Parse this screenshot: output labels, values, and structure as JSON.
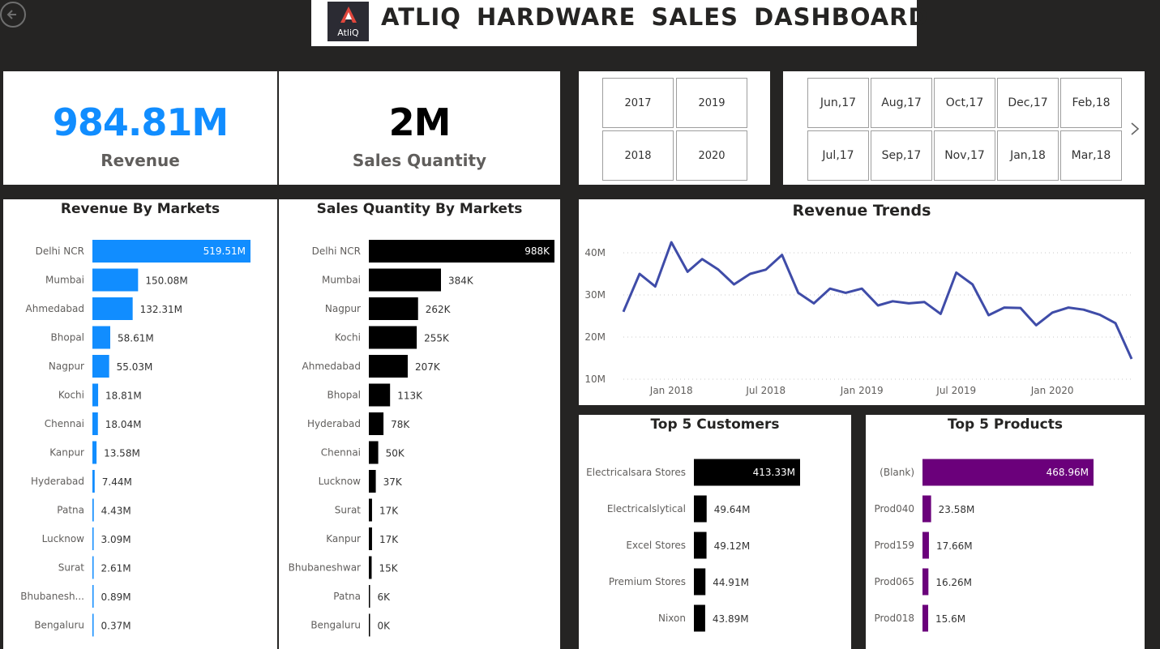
{
  "header": {
    "title": "ATLIQ  HARDWARE  SALES  DASHBOARD",
    "logo_text": "AtliQ"
  },
  "kpis": {
    "revenue": {
      "value": "984.81M",
      "label": "Revenue",
      "color": "#118dff"
    },
    "sales_qty": {
      "value": "2M",
      "label": "Sales Quantity",
      "color": "#000000"
    }
  },
  "year_slicer": {
    "options": [
      "2017",
      "2019",
      "2018",
      "2020"
    ]
  },
  "month_slicer": {
    "options": [
      "Jun,17",
      "Aug,17",
      "Oct,17",
      "Dec,17",
      "Feb,18",
      "Jul,17",
      "Sep,17",
      "Nov,17",
      "Jan,18",
      "Mar,18"
    ]
  },
  "chart_data": [
    {
      "type": "bar",
      "title": "Revenue By Markets",
      "categories": [
        "Delhi NCR",
        "Mumbai",
        "Ahmedabad",
        "Bhopal",
        "Nagpur",
        "Kochi",
        "Chennai",
        "Kanpur",
        "Hyderabad",
        "Patna",
        "Lucknow",
        "Surat",
        "Bhubanesh...",
        "Bengaluru"
      ],
      "values": [
        519.51,
        150.08,
        132.31,
        58.61,
        55.03,
        18.81,
        18.04,
        13.58,
        7.44,
        4.43,
        3.09,
        2.61,
        0.89,
        0.37
      ],
      "labels": [
        "519.51M",
        "150.08M",
        "132.31M",
        "58.61M",
        "55.03M",
        "18.81M",
        "18.04M",
        "13.58M",
        "7.44M",
        "4.43M",
        "3.09M",
        "2.61M",
        "0.89M",
        "0.37M"
      ],
      "color": "#118dff",
      "orientation": "horizontal"
    },
    {
      "type": "bar",
      "title": "Sales Quantity By Markets",
      "categories": [
        "Delhi NCR",
        "Mumbai",
        "Nagpur",
        "Kochi",
        "Ahmedabad",
        "Bhopal",
        "Hyderabad",
        "Chennai",
        "Lucknow",
        "Surat",
        "Kanpur",
        "Bhubaneshwar",
        "Patna",
        "Bengaluru"
      ],
      "values": [
        988,
        384,
        262,
        255,
        207,
        113,
        78,
        50,
        37,
        17,
        17,
        15,
        6,
        0.3
      ],
      "labels": [
        "988K",
        "384K",
        "262K",
        "255K",
        "207K",
        "113K",
        "78K",
        "50K",
        "37K",
        "17K",
        "17K",
        "15K",
        "6K",
        "0K"
      ],
      "color": "#000000",
      "orientation": "horizontal"
    },
    {
      "type": "line",
      "title": "Revenue Trends",
      "x": [
        "2017-10",
        "2017-11",
        "2017-12",
        "2018-01",
        "2018-02",
        "2018-03",
        "2018-04",
        "2018-05",
        "2018-06",
        "2018-07",
        "2018-08",
        "2018-09",
        "2018-10",
        "2018-11",
        "2018-12",
        "2019-01",
        "2019-02",
        "2019-03",
        "2019-04",
        "2019-05",
        "2019-06",
        "2019-07",
        "2019-08",
        "2019-09",
        "2019-10",
        "2019-11",
        "2019-12",
        "2020-01",
        "2020-02",
        "2020-03",
        "2020-04",
        "2020-05",
        "2020-06"
      ],
      "y": [
        26,
        35,
        32,
        42.5,
        35.5,
        38.5,
        36,
        32.5,
        35,
        36,
        39.5,
        30.5,
        28,
        31.5,
        30.5,
        31.5,
        27.5,
        28.5,
        28,
        28.3,
        25.5,
        35.3,
        32.5,
        25.2,
        27,
        26.9,
        22.8,
        25.8,
        27,
        26.5,
        25.3,
        23.3,
        14.8
      ],
      "ylim": [
        10,
        45
      ],
      "y_ticks": [
        "10M",
        "20M",
        "30M",
        "40M"
      ],
      "x_ticks": [
        "Jan 2018",
        "Jul 2018",
        "Jan 2019",
        "Jul 2019",
        "Jan 2020"
      ],
      "color": "#3f4ca8",
      "grid": true
    },
    {
      "type": "bar",
      "title": "Top 5 Customers",
      "categories": [
        "Electricalsara Stores",
        "Electricalslytical",
        "Excel Stores",
        "Premium Stores",
        "Nixon"
      ],
      "values": [
        413.33,
        49.64,
        49.12,
        44.91,
        43.89
      ],
      "labels": [
        "413.33M",
        "49.64M",
        "49.12M",
        "44.91M",
        "43.89M"
      ],
      "color": "#000000",
      "orientation": "horizontal"
    },
    {
      "type": "bar",
      "title": "Top 5 Products",
      "categories": [
        "(Blank)",
        "Prod040",
        "Prod159",
        "Prod065",
        "Prod018"
      ],
      "values": [
        468.96,
        23.58,
        17.66,
        16.26,
        15.6
      ],
      "labels": [
        "468.96M",
        "23.58M",
        "17.66M",
        "16.26M",
        "15.6M"
      ],
      "color": "#6b007b",
      "orientation": "horizontal"
    }
  ]
}
